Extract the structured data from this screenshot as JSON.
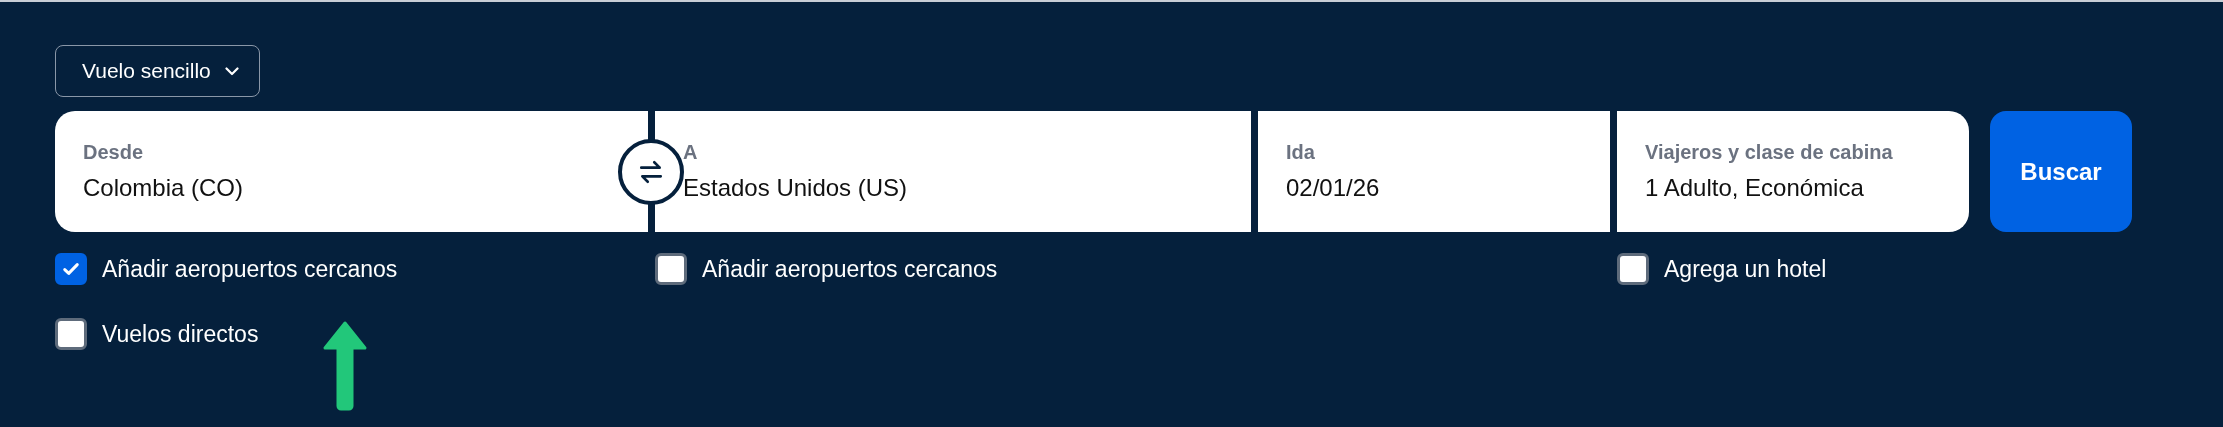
{
  "trip_type": {
    "value": "Vuelo sencillo"
  },
  "fields": [
    {
      "label": "Desde",
      "value": "Colombia (CO)",
      "options": [
        {
          "label": "Añadir aeropuertos cercanos",
          "checked": true
        },
        {
          "label": "Vuelos directos",
          "checked": false
        }
      ]
    },
    {
      "label": "A",
      "value": "Estados Unidos (US)",
      "options": [
        {
          "label": "Añadir aeropuertos cercanos",
          "checked": false
        }
      ]
    },
    {
      "label": "Ida",
      "value": "02/01/26"
    },
    {
      "label": "Viajeros y clase de cabina",
      "value": "1 Adulto, Económica",
      "options": [
        {
          "label": "Agrega un hotel",
          "checked": false
        }
      ]
    }
  ],
  "search_button": {
    "label": "Buscar"
  }
}
